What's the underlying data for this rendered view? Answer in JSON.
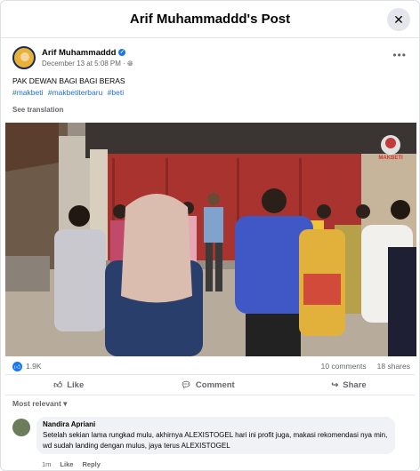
{
  "header": {
    "title": "Arif Muhammaddd's Post"
  },
  "post": {
    "author": "Arif Muhammaddd",
    "date": "December 13 at 5:08 PM",
    "caption": "PAK DEWAN  BAGI BAGI BERAS",
    "hashtags": [
      "#makbeti",
      "#makbetiterbaru",
      "#beti"
    ],
    "see_translation": "See translation",
    "watermark": "MAKBETI"
  },
  "stats": {
    "reactions": "1.9K",
    "comments": "10 comments",
    "shares": "18 shares"
  },
  "actions": {
    "like": "Like",
    "comment": "Comment",
    "share": "Share"
  },
  "comments_filter": "Most relevant",
  "comment": {
    "name": "Nandira Apriani",
    "text": "Setelah sekian lama rungkad mulu, akhirnya ALEXISTOGEL hari ini profit juga, makasi rekomendasi nya min, wd sudah landing dengan mulus, jaya terus ALEXISTOGEL",
    "time": "1m",
    "like": "Like",
    "reply": "Reply"
  },
  "colors": {
    "accent": "#1877f2",
    "link": "#216fdb",
    "muted": "#65676b"
  }
}
